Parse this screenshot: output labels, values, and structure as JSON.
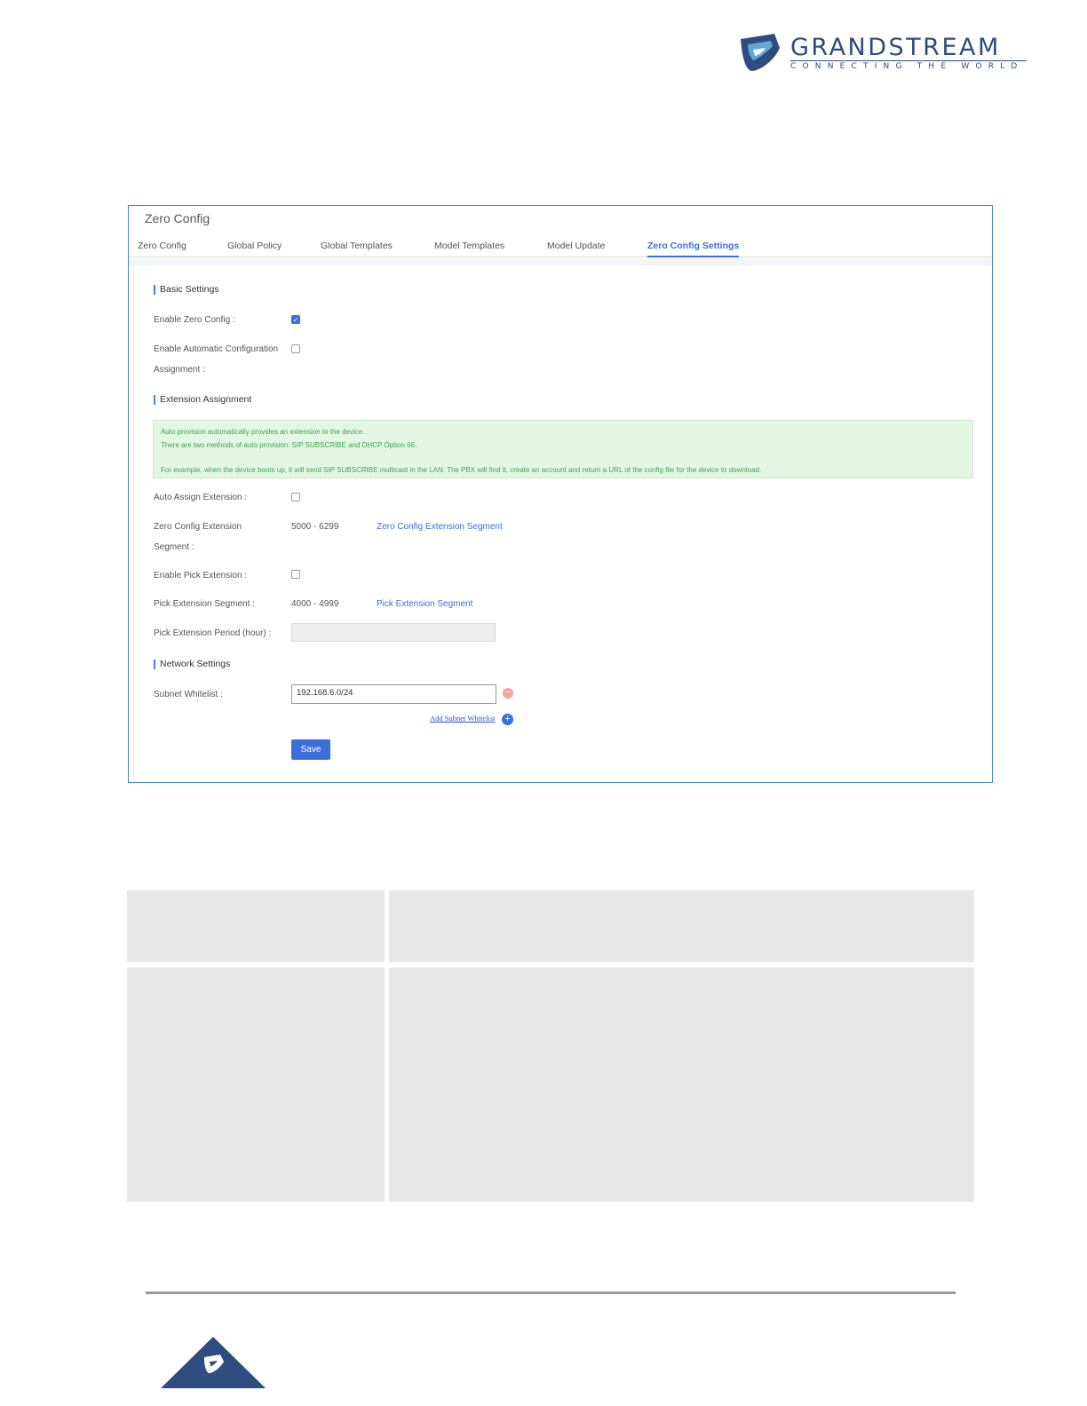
{
  "logo": {
    "name": "GRANDSTREAM",
    "tagline": "CONNECTING THE WORLD"
  },
  "window": {
    "title": "Zero Config",
    "tabs": [
      {
        "label": "Zero Config"
      },
      {
        "label": "Global Policy"
      },
      {
        "label": "Global Templates"
      },
      {
        "label": "Model Templates"
      },
      {
        "label": "Model Update"
      },
      {
        "label": "Zero Config Settings",
        "active": true
      }
    ]
  },
  "basic": {
    "heading": "Basic Settings",
    "enable_zero_config_label": "Enable Zero Config :",
    "enable_zero_config": true,
    "auto_config_label_line1": "Enable Automatic Configuration",
    "auto_config_label_line2": "Assignment :",
    "auto_config": false
  },
  "extension": {
    "heading": "Extension Assignment",
    "info_line1": "Auto provision automatically provides an extension to the device.",
    "info_line2": "There are two methods of auto provision: SIP SUBSCRIBE and DHCP Option 66.",
    "info_line3": "For example, when the device boots up, it will send SIP SUBSCRIBE multicast in the LAN. The PBX will find it, create an account and return a URL of the config file for the device to download.",
    "auto_assign_label": "Auto Assign Extension :",
    "auto_assign": false,
    "segment_label_line1": "Zero Config Extension",
    "segment_label_line2": "Segment :",
    "segment_value": "5000 - 6299",
    "segment_link": "Zero Config Extension Segment",
    "pick_label": "Enable Pick Extension :",
    "pick": false,
    "pick_segment_label": "Pick Extension Segment :",
    "pick_segment_value": "4000 - 4999",
    "pick_segment_link": "Pick Extension Segment",
    "pick_period_label": "Pick Extension Period (hour) :",
    "pick_period_value": ""
  },
  "network": {
    "heading": "Network Settings",
    "subnet_label": "Subnet Whitelist :",
    "subnet_value": "192.168.6.0/24",
    "add_subnet_link": "Add Subnet Whitelist"
  },
  "save_label": "Save"
}
